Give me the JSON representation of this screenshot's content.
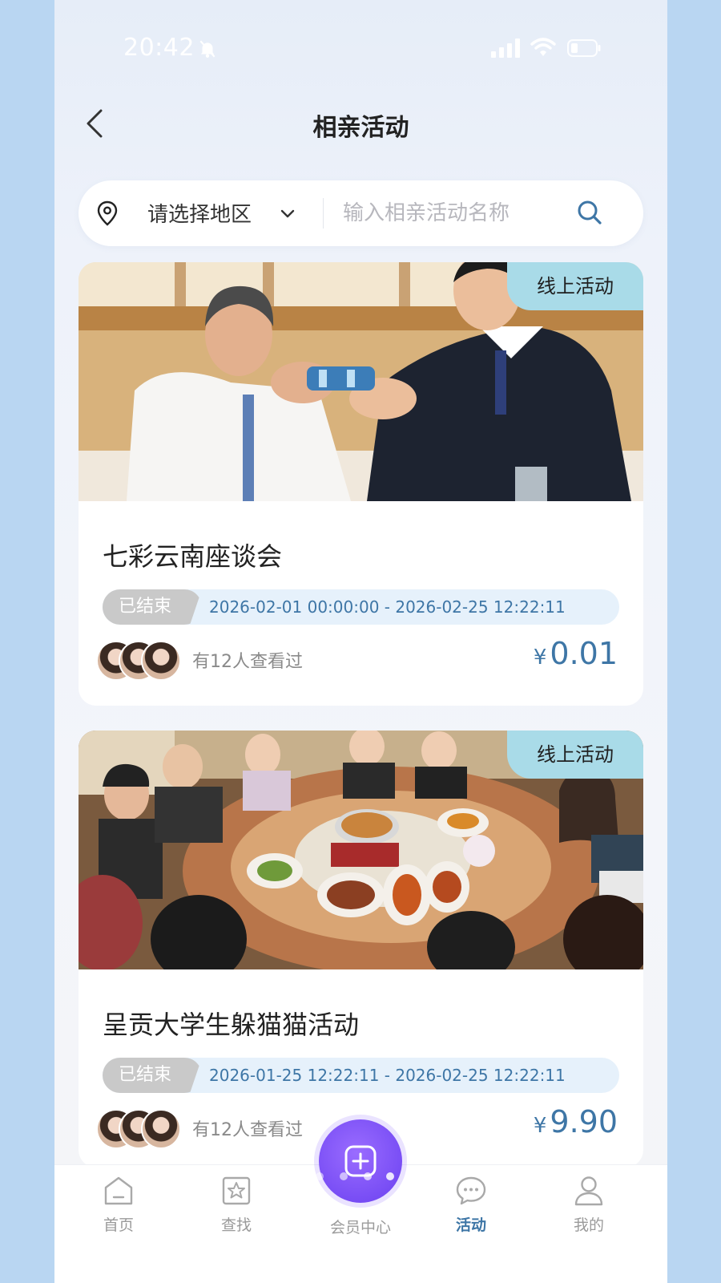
{
  "status_bar": {
    "time": "20:42"
  },
  "header": {
    "title": "相亲活动"
  },
  "search": {
    "region_label": "请选择地区",
    "placeholder": "输入相亲活动名称"
  },
  "events": [
    {
      "tag": "线上活动",
      "title": "七彩云南座谈会",
      "status": "已结束",
      "date_range": "2026-02-01 00:00:00 - 2026-02-25 12:22:11",
      "views": "有12人查看过",
      "currency": "¥",
      "price": "0.01"
    },
    {
      "tag": "线上活动",
      "title": "呈贡大学生躲猫猫活动",
      "status": "已结束",
      "date_range": "2026-01-25 12:22:11 - 2026-02-25 12:22:11",
      "views": "有12人查看过",
      "currency": "¥",
      "price": "9.90"
    }
  ],
  "tabbar": {
    "items": [
      {
        "label": "首页",
        "icon": "home-icon"
      },
      {
        "label": "查找",
        "icon": "star-search-icon"
      },
      {
        "label": "会员中心",
        "icon": "plus-icon"
      },
      {
        "label": "活动",
        "icon": "chat-bubble-icon",
        "active": true
      },
      {
        "label": "我的",
        "icon": "person-icon"
      }
    ]
  },
  "colors": {
    "accent": "#3e76a6",
    "tag_bg": "#a9dbe8",
    "fab": "#7a4ff5"
  }
}
